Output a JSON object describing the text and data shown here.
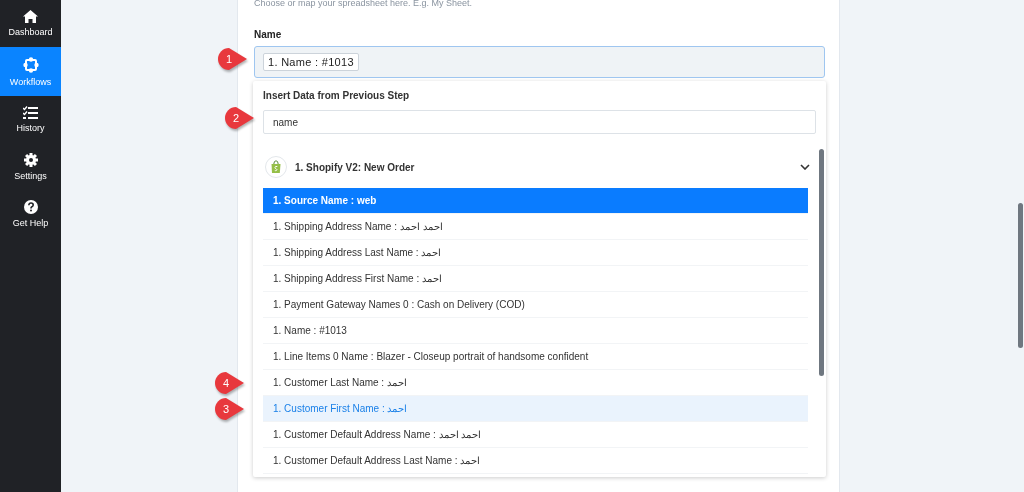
{
  "sidebar": {
    "items": [
      {
        "label": "Dashboard",
        "selected": false
      },
      {
        "label": "Workflows",
        "selected": true
      },
      {
        "label": "History",
        "selected": false
      },
      {
        "label": "Settings",
        "selected": false
      },
      {
        "label": "Get Help",
        "selected": false
      }
    ]
  },
  "form": {
    "hint": "Choose or map your spreadsheet here. E.g. My Sheet.",
    "label": "Name",
    "value_chip": "1. Name : #1013",
    "marker": "1"
  },
  "dropdown": {
    "title": "Insert Data from Previous Step",
    "search": {
      "value": "name",
      "marker": "2"
    },
    "group": {
      "title": "1. Shopify V2: New Order",
      "expanded": true
    },
    "items": [
      {
        "text": "1. Source Name : web",
        "selected": true,
        "hovered": false
      },
      {
        "text": "1. Shipping Address Name : احمد احمد",
        "selected": false,
        "hovered": false
      },
      {
        "text": "1. Shipping Address Last Name : احمد",
        "selected": false,
        "hovered": false
      },
      {
        "text": "1. Shipping Address First Name : احمد",
        "selected": false,
        "hovered": false
      },
      {
        "text": "1. Payment Gateway Names 0 : Cash on Delivery (COD)",
        "selected": false,
        "hovered": false
      },
      {
        "text": "1. Name : #1013",
        "selected": false,
        "hovered": false
      },
      {
        "text": "1. Line Items 0 Name : Blazer - Closeup portrait of handsome confident",
        "selected": false,
        "hovered": false
      },
      {
        "text": "1. Customer Last Name : احمد",
        "selected": false,
        "hovered": false,
        "marker": "4"
      },
      {
        "text": "1. Customer First Name : احمد",
        "selected": false,
        "hovered": true,
        "marker": "3"
      },
      {
        "text": "1. Customer Default Address Name : احمد احمد",
        "selected": false,
        "hovered": false
      },
      {
        "text": "1. Customer Default Address Last Name : احمد",
        "selected": false,
        "hovered": false
      }
    ]
  }
}
